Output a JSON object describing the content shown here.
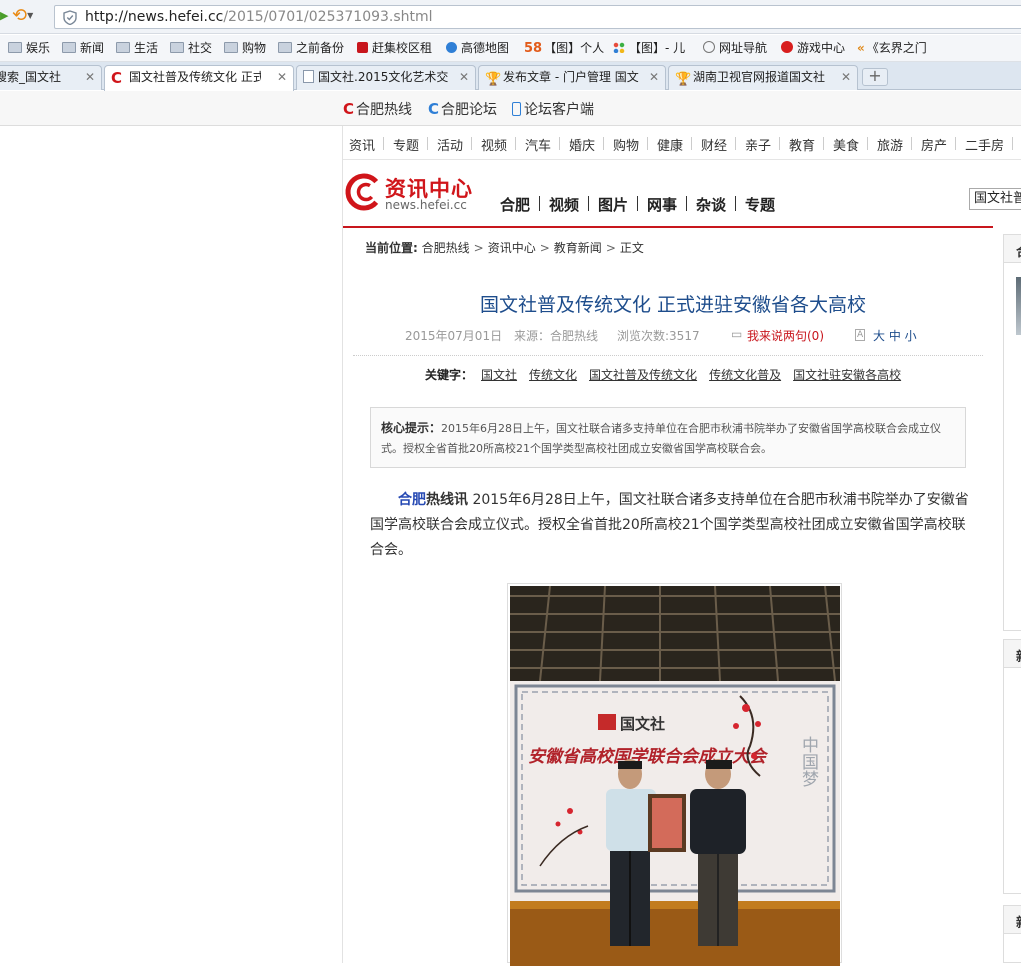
{
  "browser": {
    "url_host": "http://news.hefei.cc",
    "url_path": "/2015/0701/025371093.shtml",
    "bookmarks": [
      "娱乐",
      "新闻",
      "生活",
      "社交",
      "购物",
      "之前备份",
      "赶集校区租",
      "高德地图",
      "【图】个人",
      "【图】- 儿",
      "网址导航",
      "游戏中心",
      "《玄界之门"
    ],
    "bookmark_58": "58",
    "tabs": [
      {
        "title": "搜索_国文社"
      },
      {
        "title": "国文社普及传统文化 正式"
      },
      {
        "title": "国文社.2015文化艺术交"
      },
      {
        "title": "发布文章 - 门户管理 国文"
      },
      {
        "title": "湖南卫视官网报道国文社"
      }
    ],
    "new_tab": "+"
  },
  "site": {
    "top_links": [
      "合肥热线",
      "合肥论坛",
      "论坛客户端"
    ],
    "categories": [
      "资讯",
      "专题",
      "活动",
      "视频",
      "汽车",
      "婚庆",
      "购物",
      "健康",
      "财经",
      "亲子",
      "教育",
      "美食",
      "旅游",
      "房产",
      "二手房"
    ],
    "logo_title": "资讯中心",
    "logo_domain": "news.hefei.cc",
    "main_nav": [
      "合肥",
      "视频",
      "图片",
      "网事",
      "杂谈",
      "专题"
    ],
    "search_value": "国文社普及传统文化",
    "sidebar_heads": [
      "合",
      "新",
      "新"
    ]
  },
  "breadcrumb": {
    "label": "当前位置:",
    "items": [
      "合肥热线",
      "资讯中心",
      "教育新闻",
      "正文"
    ]
  },
  "article": {
    "title": "国文社普及传统文化  正式进驻安徽省各大高校",
    "date": "2015年07月01日",
    "source": "来源：合肥热线",
    "views": "浏览次数:3517",
    "comment": "我来说两句(0)",
    "font_sizes": "大 中 小",
    "keywords_label": "关键字：",
    "keywords": [
      "国文社",
      "传统文化",
      "国文社普及传统文化",
      "传统文化普及",
      "国文社驻安徽各高校"
    ],
    "summary_label": "核心提示：",
    "summary": "2015年6月28日上午，国文社联合诸多支持单位在合肥市秋浦书院举办了安徽省国学高校联合会成立仪式。授权全省首批20所高校21个国学类型高校社团成立安徽省国学高校联合会。",
    "body_lead_a": "合肥",
    "body_lead_b": "热线讯",
    "body": "2015年6月28日上午，国文社联合诸多支持单位在合肥市秋浦书院举办了安徽省国学高校联合会成立仪式。授权全省首批20所高校21个国学类型高校社团成立安徽省国学高校联合会。"
  },
  "photo": {
    "backdrop_logo": "国文社",
    "backdrop_banner": "安徽省高校国学联合会成立大会",
    "backdrop_side": "中国梦"
  },
  "colors": {
    "brand_red": "#c8161d",
    "title_blue": "#1e4d8c",
    "link_blue": "#2649b3"
  }
}
